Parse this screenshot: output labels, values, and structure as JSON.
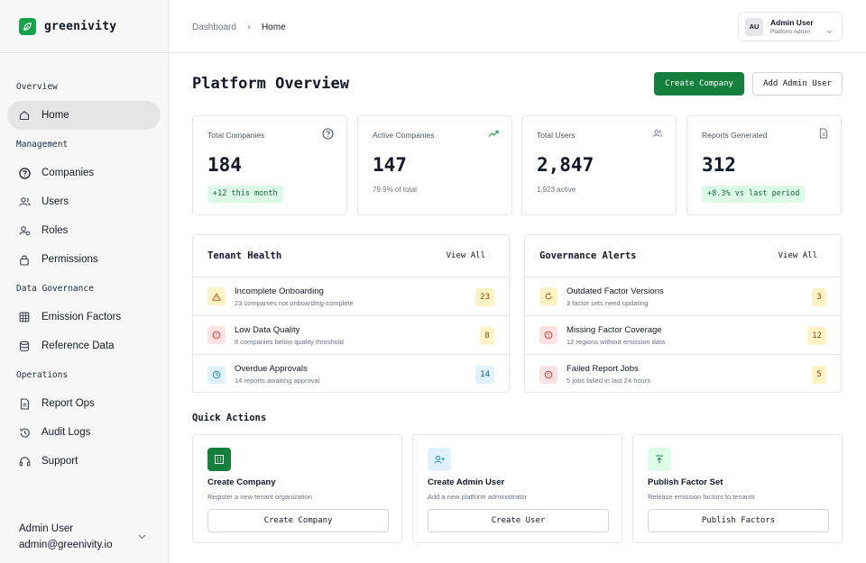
{
  "brand": {
    "name": "greenivity",
    "color": "#16a34a"
  },
  "sidebar": {
    "sections": [
      {
        "title": "Overview",
        "items": [
          {
            "label": "Home",
            "icon": "home-icon",
            "active": true
          }
        ]
      },
      {
        "title": "Management",
        "items": [
          {
            "label": "Companies",
            "icon": "help-circle-icon"
          },
          {
            "label": "Users",
            "icon": "users-icon"
          },
          {
            "label": "Roles",
            "icon": "user-check-icon"
          },
          {
            "label": "Permissions",
            "icon": "lock-icon"
          }
        ]
      },
      {
        "title": "Data Governance",
        "items": [
          {
            "label": "Emission Factors",
            "icon": "grid-icon"
          },
          {
            "label": "Reference Data",
            "icon": "database-icon"
          }
        ]
      },
      {
        "title": "Operations",
        "items": [
          {
            "label": "Report Ops",
            "icon": "file-icon"
          },
          {
            "label": "Audit Logs",
            "icon": "history-icon"
          },
          {
            "label": "Support",
            "icon": "headphones-icon"
          }
        ]
      }
    ],
    "user": {
      "name": "Admin User",
      "email": "admin@greenivity.io"
    }
  },
  "topbar": {
    "breadcrumb": [
      "Dashboard",
      "Home"
    ],
    "user": {
      "initials": "AU",
      "name": "Admin User",
      "role": "Platform Admin"
    }
  },
  "page": {
    "title": "Platform Overview",
    "primary_action": "Create Company",
    "secondary_action": "Add Admin User"
  },
  "stats": [
    {
      "label": "Total Companies",
      "value": "184",
      "badge": "+12 this month",
      "icon": "help-circle-icon"
    },
    {
      "label": "Active Companies",
      "value": "147",
      "sub": "79.9% of total",
      "icon": "trending-up-icon"
    },
    {
      "label": "Total Users",
      "value": "2,847",
      "sub": "1,923 active",
      "icon": "users-icon"
    },
    {
      "label": "Reports Generated",
      "value": "312",
      "badge": "+8.3% vs last period",
      "icon": "file-icon"
    }
  ],
  "tenant_health": {
    "title": "Tenant Health",
    "link": "View All",
    "rows": [
      {
        "title": "Incomplete Onboarding",
        "sub": "23 companies not onboarding-complete",
        "count": "23",
        "tone": "amber",
        "icon": "warning-icon"
      },
      {
        "title": "Low Data Quality",
        "sub": "8 companies below quality threshold",
        "count": "8",
        "tone": "amber",
        "icon": "alert-circle-icon",
        "icon_tone": "red"
      },
      {
        "title": "Overdue Approvals",
        "sub": "14 reports awaiting approval",
        "count": "14",
        "tone": "blue",
        "icon": "clock-icon"
      }
    ]
  },
  "governance_alerts": {
    "title": "Governance Alerts",
    "link": "View All",
    "rows": [
      {
        "title": "Outdated Factor Versions",
        "sub": "3 factor sets need updating",
        "count": "3",
        "tone": "amber",
        "icon": "refresh-icon"
      },
      {
        "title": "Missing Factor Coverage",
        "sub": "12 regions without emission data",
        "count": "12",
        "tone": "amber",
        "icon": "alert-circle-icon",
        "icon_tone": "red"
      },
      {
        "title": "Failed Report Jobs",
        "sub": "5 jobs failed in last 24 hours",
        "count": "5",
        "tone": "amber",
        "icon": "alert-circle-icon",
        "icon_tone": "red"
      }
    ]
  },
  "quick_actions": {
    "title": "Quick Actions",
    "cards": [
      {
        "name": "Create Company",
        "desc": "Register a new tenant organization",
        "button": "Create Company",
        "icon": "building-icon"
      },
      {
        "name": "Create Admin User",
        "desc": "Add a new platform administrator",
        "button": "Create User",
        "icon": "user-plus-icon"
      },
      {
        "name": "Publish Factor Set",
        "desc": "Release emission factors to tenants",
        "button": "Publish Factors",
        "icon": "upload-icon"
      }
    ]
  },
  "colors": {
    "primary": "#15803d",
    "badge_green_bg": "#dcfce7",
    "amber_bg": "#fef3c7",
    "blue_bg": "#e0f2fe",
    "red_bg": "#fde2e4"
  }
}
